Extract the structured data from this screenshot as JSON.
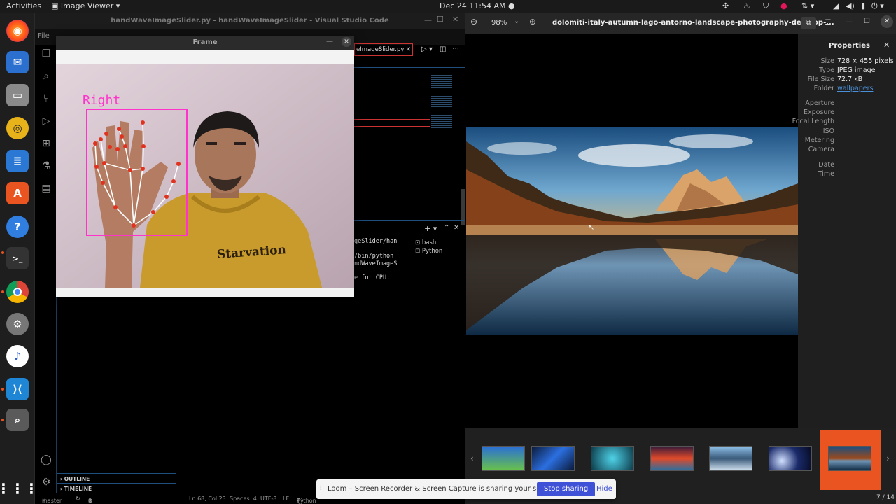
{
  "topbar": {
    "activities": "Activities",
    "app_menu": "Image Viewer",
    "clock": "Dec 24  11:54 AM"
  },
  "vscode": {
    "title": "handWaveImageSlider.py - handWaveImageSlider - Visual Studio Code",
    "menu_file": "File",
    "tab_label": "eImageSlider.py",
    "terminal_lines": [
      "geSlider/han",
      "/bin/python",
      "ndWaveImageS",
      "e for CPU."
    ],
    "terminal_list": [
      "bash",
      "Python"
    ],
    "outline": "OUTLINE",
    "timeline": "TIMELINE",
    "status": {
      "branch": "master",
      "problems": "0",
      "warnings": "0",
      "position": "Ln 68, Col 23",
      "spaces": "Spaces: 4",
      "encoding": "UTF-8",
      "eol": "LF",
      "language": "Python"
    }
  },
  "frame": {
    "title": "Frame",
    "hand_label": "Right",
    "shirt_text": "Starvation"
  },
  "viewer": {
    "zoom": "98%",
    "filename": "dolomiti-italy-autumn-lago-antorno-landscape-photography-desktop-...",
    "properties_title": "Properties",
    "properties": [
      {
        "key": "Size",
        "value": "728 × 455 pixels"
      },
      {
        "key": "Type",
        "value": "JPEG image"
      },
      {
        "key": "File Size",
        "value": "72.7 kB"
      },
      {
        "key": "Folder",
        "value": "wallpapers"
      }
    ],
    "exif_keys": [
      "Aperture",
      "Exposure",
      "Focal Length",
      "ISO",
      "Metering",
      "Camera"
    ],
    "date_keys": [
      "Date",
      "Time"
    ],
    "counter": "7 / 14"
  },
  "loom": {
    "message": "Loom – Screen Recorder & Screen Capture is sharing your screen.",
    "stop": "Stop sharing",
    "hide": "Hide"
  },
  "colors": {
    "accent": "#e95420",
    "link": "#4a90d9",
    "loom_button": "#3f51d6",
    "hand_box": "#ff33cc",
    "landmark": "#e0321e"
  }
}
